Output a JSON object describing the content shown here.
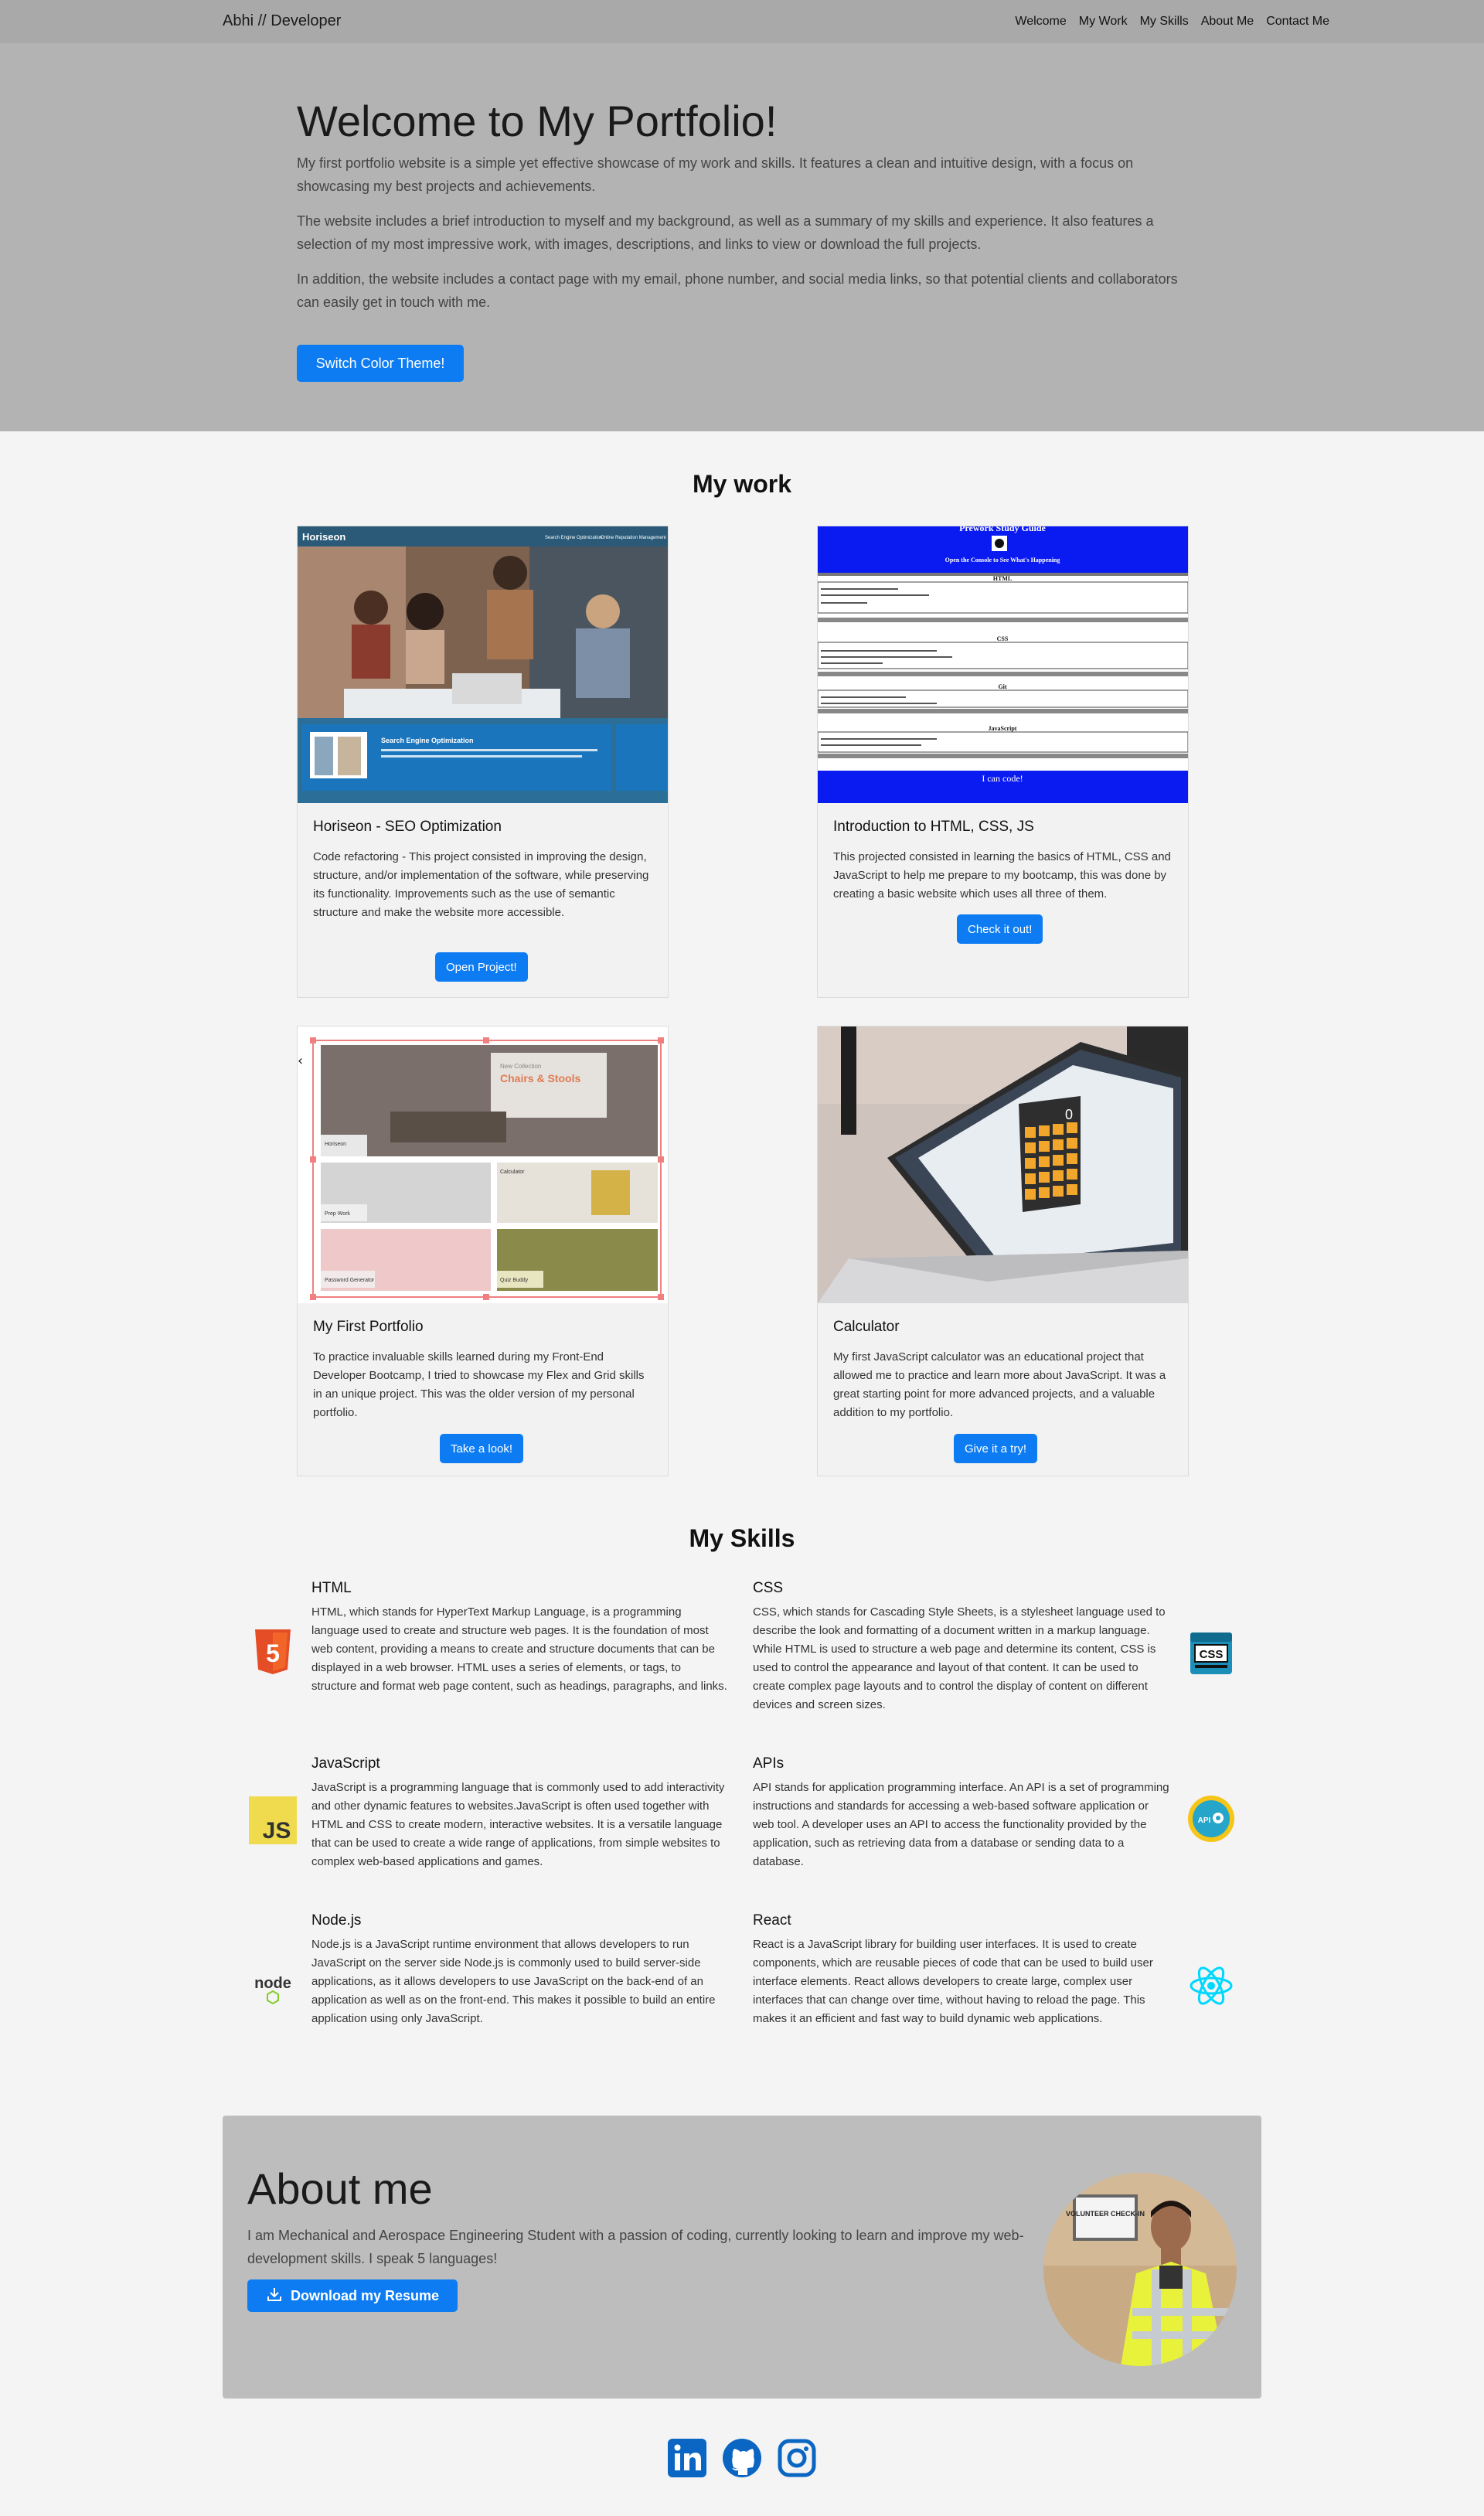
{
  "nav": {
    "brand": "Abhi // Developer",
    "links": [
      "Welcome",
      "My Work",
      "My Skills",
      "About Me",
      "Contact Me"
    ]
  },
  "hero": {
    "title": "Welcome to My Portfolio!",
    "p1": "My first portfolio website is a simple yet effective showcase of my work and skills. It features a clean and intuitive design, with a focus on showcasing my best projects and achievements.",
    "p2": "The website includes a brief introduction to myself and my background, as well as a summary of my skills and experience. It also features a selection of my most impressive work, with images, descriptions, and links to view or download the full projects.",
    "p3": "In addition, the website includes a contact page with my email, phone number, and social media links, so that potential clients and collaborators can easily get in touch with me.",
    "button": "Switch Color Theme!"
  },
  "work": {
    "title": "My work",
    "cards": [
      {
        "title": "Horiseon - SEO Optimization",
        "text": "Code refactoring - This project consisted in improving the design, structure, and/or implementation of the software, while preserving its functionality. Improvements such as the use of semantic structure and make the website more accessible.",
        "button": "Open Project!",
        "thumb": {
          "header": "Horiseon",
          "nav1": "Search Engine Optimization",
          "nav2": "Online Reputation Management",
          "box": "Search Engine Optimization"
        }
      },
      {
        "title": "Introduction to HTML, CSS, JS",
        "text": "This projected consisted in learning the basics of HTML, CSS and JavaScript to help me prepare to my bootcamp, this was done by creating a basic website which uses all three of them.",
        "button": "Check it out!",
        "thumb": {
          "header": "Prework Study Guide",
          "console": "Open the Console to See What's Happening",
          "topics": [
            "HTML",
            "CSS",
            "Git",
            "JavaScript"
          ],
          "footer": "I can code!"
        }
      },
      {
        "title": "My First Portfolio",
        "text": "To practice invaluable skills learned during my Front-End Developer Bootcamp, I tried to showcase my Flex and Grid skills in an unique project. This was the older version of my personal portfolio.",
        "button": "Take a look!",
        "thumb": {
          "banner_small": "New Collection",
          "banner": "Chairs & Stools",
          "tiles": [
            "Horiseon",
            "Prep Work",
            "Calculator",
            "Password Generator",
            "Quiz Buddy"
          ]
        }
      },
      {
        "title": "Calculator",
        "text": "My first JavaScript calculator was an educational project that allowed me to practice and learn more about JavaScript. It was a great starting point for more advanced projects, and a valuable addition to my portfolio.",
        "button": "Give it a try!",
        "thumb": {
          "display": "0"
        }
      }
    ]
  },
  "skills": {
    "title": "My Skills",
    "items": [
      {
        "title": "HTML",
        "text": "HTML, which stands for HyperText Markup Language, is a programming language used to create and structure web pages. It is the foundation of most web content, providing a means to create and structure documents that can be displayed in a web browser. HTML uses a series of elements, or tags, to structure and format web page content, such as headings, paragraphs, and links.",
        "icon": "html5-icon",
        "badge": "5"
      },
      {
        "title": "CSS",
        "text": "CSS, which stands for Cascading Style Sheets, is a stylesheet language used to describe the look and formatting of a document written in a markup language. While HTML is used to structure a web page and determine its content, CSS is used to control the appearance and layout of that content. It can be used to create complex page layouts and to control the display of content on different devices and screen sizes.",
        "icon": "css-icon",
        "badge": "CSS"
      },
      {
        "title": "JavaScript",
        "text": "JavaScript is a programming language that is commonly used to add interactivity and other dynamic features to websites.JavaScript is often used together with HTML and CSS to create modern, interactive websites. It is a versatile language that can be used to create a wide range of applications, from simple websites to complex web-based applications and games.",
        "icon": "js-icon",
        "badge": "JS"
      },
      {
        "title": "APIs",
        "text": "API stands for application programming interface. An API is a set of programming instructions and standards for accessing a web-based software application or web tool. A developer uses an API to access the functionality provided by the application, such as retrieving data from a database or sending data to a database.",
        "icon": "api-icon",
        "badge": "API"
      },
      {
        "title": "Node.js",
        "text": "Node.js is a JavaScript runtime environment that allows developers to run JavaScript on the server side Node.js is commonly used to build server-side applications, as it allows developers to use JavaScript on the back-end of an application as well as on the front-end. This makes it possible to build an entire application using only JavaScript.",
        "icon": "nodejs-icon",
        "badge": "node"
      },
      {
        "title": "React",
        "text": "React is a JavaScript library for building user interfaces. It is used to create components, which are reusable pieces of code that can be used to build user interface elements. React allows developers to create large, complex user interfaces that can change over time, without having to reload the page. This makes it an efficient and fast way to build dynamic web applications.",
        "icon": "react-icon",
        "badge": ""
      }
    ]
  },
  "about": {
    "title": "About me",
    "text": "I am Mechanical and Aerospace Engineering Student with a passion of coding, currently looking to learn and improve my web-development skills. I speak 5 languages!",
    "button": "Download my Resume",
    "photo_sign": "VOLUNTEER CHECK-IN"
  },
  "social": [
    "linkedin-icon",
    "github-icon",
    "instagram-icon"
  ],
  "colors": {
    "accent": "#0d7cf2",
    "navbar": "#a9a9a9",
    "hero": "#b3b3b3",
    "about": "#bdbdbd",
    "social": "#0a66c2"
  }
}
